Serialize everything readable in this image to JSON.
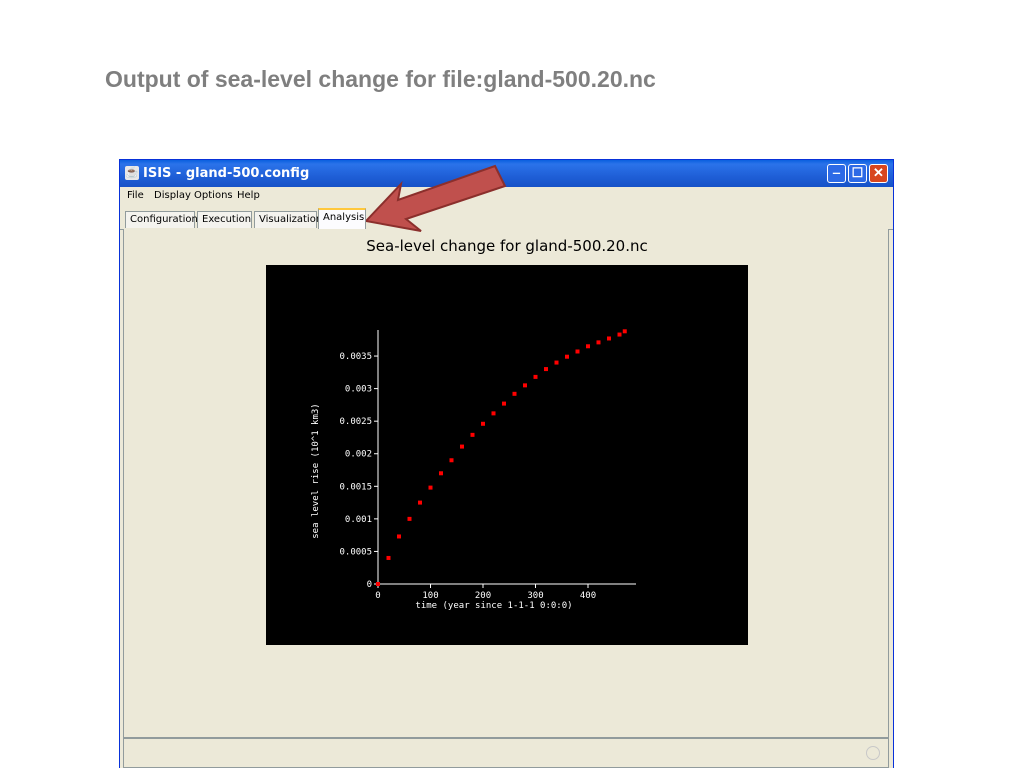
{
  "slide": {
    "title": "Output of sea-level change for file:gland-500.20.nc"
  },
  "window": {
    "title": "ISIS - gland-500.config",
    "controls": {
      "minimize_icon": "minimize-icon",
      "maximize_icon": "maximize-icon",
      "close_icon": "close-icon"
    }
  },
  "menu": {
    "items": [
      "File",
      "Display Options",
      "Help"
    ]
  },
  "tabs": [
    {
      "label": "Configuration",
      "active": false
    },
    {
      "label": "Execution",
      "active": false
    },
    {
      "label": "Visualization",
      "active": false
    },
    {
      "label": "Analysis",
      "active": true
    }
  ],
  "annotation": {
    "icon": "red-arrow-pointer-icon",
    "color": "#c0504d"
  },
  "chart_data": {
    "type": "scatter",
    "title": "Sea-level change for gland-500.20.nc",
    "xlabel": "time (year since 1-1-1 0:0:0)",
    "ylabel": "sea level rise (10^1 km3)",
    "xticks": [
      "0",
      "100",
      "200",
      "300",
      "400"
    ],
    "yticks": [
      "0",
      "0.0005",
      "0.001",
      "0.0015",
      "0.002",
      "0.0025",
      "0.003",
      "0.0035"
    ],
    "xlim": [
      0,
      480
    ],
    "ylim": [
      0,
      0.0039
    ],
    "background": "#000000",
    "point_color": "#ff0000",
    "series": [
      {
        "x": [
          0,
          20,
          40,
          60,
          80,
          100,
          120,
          140,
          160,
          180,
          200,
          220,
          240,
          260,
          280,
          300,
          320,
          340,
          360,
          380,
          400,
          420,
          440,
          460,
          470
        ],
        "y": [
          0,
          0.0004,
          0.00073,
          0.001,
          0.00125,
          0.00148,
          0.0017,
          0.0019,
          0.00211,
          0.00229,
          0.00246,
          0.00262,
          0.00277,
          0.00292,
          0.00305,
          0.00318,
          0.0033,
          0.0034,
          0.00349,
          0.00357,
          0.00365,
          0.00371,
          0.00377,
          0.00383,
          0.00388
        ]
      }
    ]
  }
}
